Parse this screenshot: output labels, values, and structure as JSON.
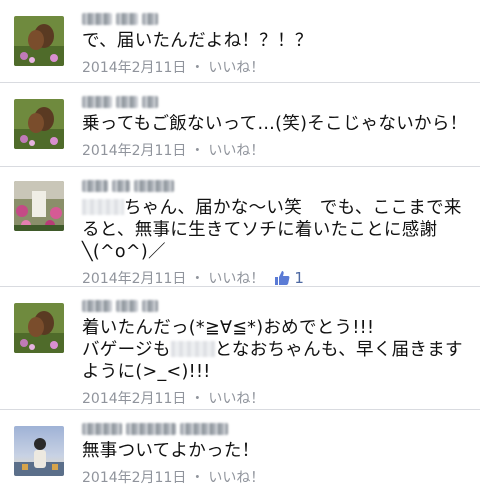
{
  "comments": [
    {
      "text": "で、届いたんだよね！？！？",
      "date": "2014年2月11日",
      "like_label": "いいね！"
    },
    {
      "text": "乗ってもご飯ないって…(笑)そこじゃないから！",
      "date": "2014年2月11日",
      "like_label": "いいね！"
    },
    {
      "text_after_blur": "ちゃん、届かな〜い笑　でも、ここまで来ると、無事に生きてソチに着いたことに感謝╲(^o^)／",
      "date": "2014年2月11日",
      "like_label": "いいね！",
      "like_count": "1"
    },
    {
      "text_line1": "着いたんだっ(*≧∀≦*)おめでとう!!!",
      "text_before_blur": "バゲージも",
      "text_after_blur": "となおちゃんも、早く届きますように(>_<)!!!",
      "date": "2014年2月11日",
      "like_label": "いいね！"
    },
    {
      "text": "無事ついてよかった！",
      "date": "2014年2月11日",
      "like_label": "いいね！"
    }
  ],
  "meta_separator": "・",
  "colors": {
    "text": "#111111",
    "meta": "#90949c",
    "like_accent": "#4e69a2",
    "divider": "#d9dbe0"
  },
  "icons": {
    "like_count_icon": "thumbs-up-icon"
  }
}
